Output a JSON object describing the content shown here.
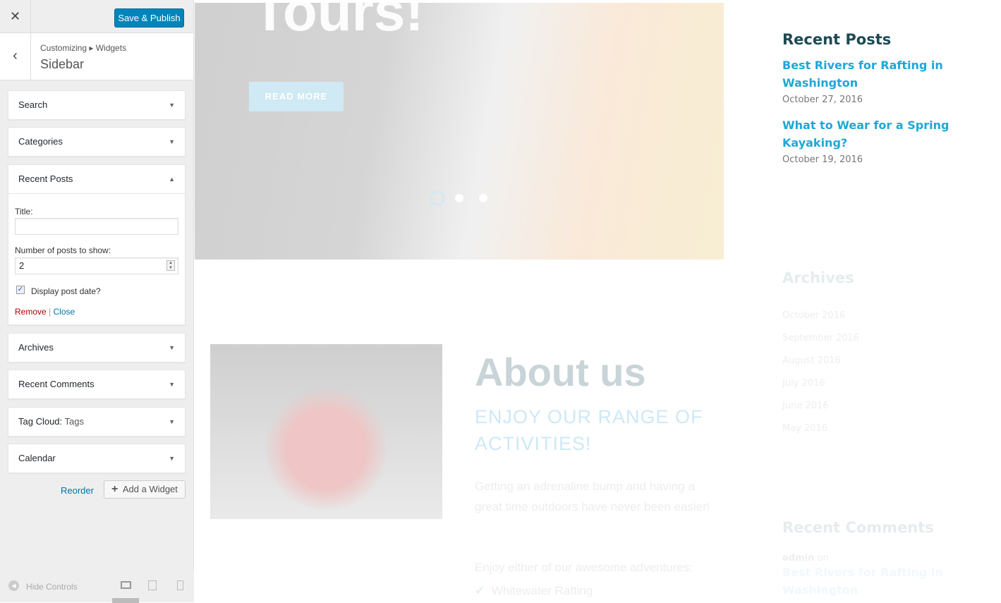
{
  "header": {
    "close_icon": "close-icon",
    "save_label": "Save & Publish"
  },
  "title": {
    "breadcrumb": "Customizing ▸ Widgets",
    "section": "Sidebar"
  },
  "widgets": [
    {
      "label": "Search"
    },
    {
      "label": "Categories"
    },
    {
      "label": "Recent Posts"
    },
    {
      "label": "Archives"
    },
    {
      "label": "Recent Comments"
    },
    {
      "label": "Tag Cloud:",
      "sub": "Tags"
    },
    {
      "label": "Calendar"
    }
  ],
  "recent_posts_form": {
    "title_label": "Title:",
    "title_value": "",
    "count_label": "Number of posts to show:",
    "count_value": "2",
    "display_date_label": "Display post date?",
    "display_date_checked": true,
    "remove": "Remove",
    "sep": "|",
    "close": "Close"
  },
  "actions": {
    "reorder": "Reorder",
    "add_widget": "Add a Widget"
  },
  "footer": {
    "hide_controls": "Hide Controls",
    "devices": [
      "desktop",
      "tablet",
      "mobile"
    ],
    "active_device": "desktop"
  },
  "preview": {
    "hero_title": "Tours!",
    "read_more": "READ MORE",
    "about_title": "About us",
    "about_subtitle": "ENJOY OUR RANGE OF ACTIVITIES!",
    "about_text": "Getting an adrenaline bump and having a great time outdoors have never been easier!",
    "about_text2": "Enjoy either of our awesome adventures:",
    "activity": "Whitewater Rafting",
    "recent_posts_title": "Recent Posts",
    "posts": [
      {
        "title": "Best Rivers for Rafting in Washington",
        "date": "October 27, 2016"
      },
      {
        "title": "What to Wear for a Spring Kayaking?",
        "date": "October 19, 2016"
      }
    ],
    "archives_title": "Archives",
    "archives": [
      "October 2016",
      "September 2016",
      "August 2016",
      "July 2016",
      "June 2016",
      "May 2016"
    ],
    "recent_comments_title": "Recent Comments",
    "comment_author": "admin",
    "comment_on": "on",
    "comment_post": "Best Rivers for Rafting in Washington"
  },
  "colors": {
    "primary": "#0085ba",
    "link": "#0073aa",
    "remove": "#aa0000",
    "accent": "#1ea7d9",
    "heading": "#1c4a55"
  }
}
